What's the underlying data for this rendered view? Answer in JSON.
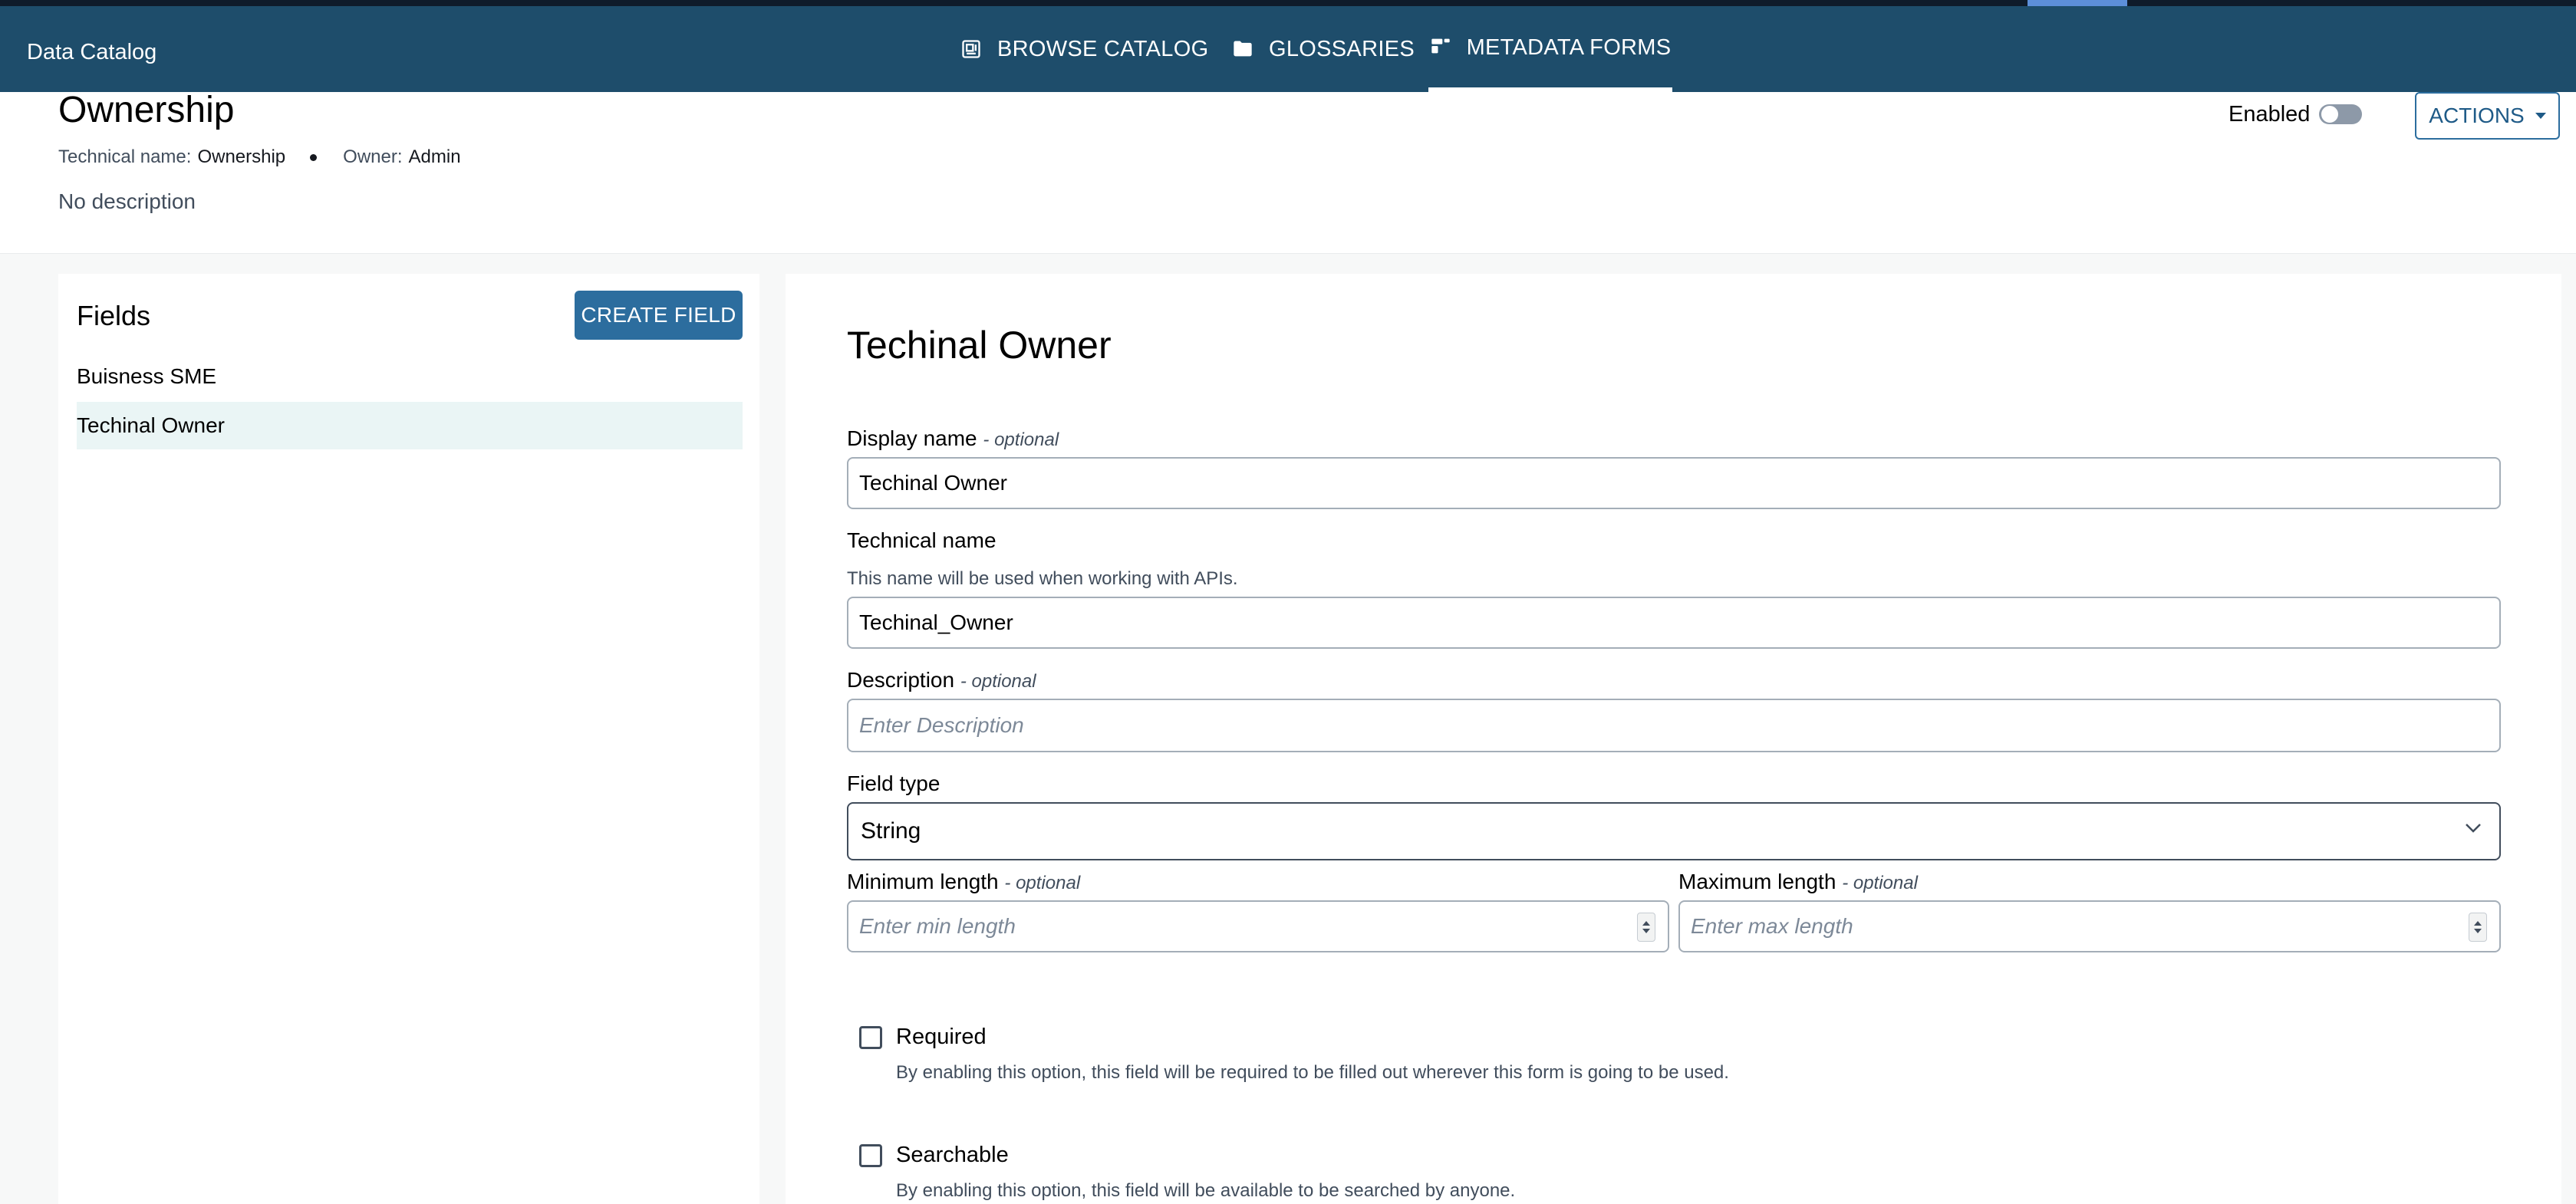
{
  "navbar": {
    "brand": "Data Catalog",
    "tabs": [
      {
        "label": "BROWSE CATALOG",
        "icon": "catalog-icon"
      },
      {
        "label": "GLOSSARIES",
        "icon": "folder-icon"
      },
      {
        "label": "METADATA FORMS",
        "icon": "form-icon",
        "active": true
      }
    ]
  },
  "header": {
    "title": "Ownership",
    "technical_name_label": "Technical name:",
    "technical_name_value": "Ownership",
    "owner_label": "Owner:",
    "owner_value": "Admin",
    "description": "No description",
    "enabled_label": "Enabled",
    "enabled": false,
    "actions_label": "ACTIONS"
  },
  "fields_panel": {
    "title": "Fields",
    "create_button": "CREATE FIELD",
    "items": [
      {
        "label": "Buisness SME",
        "selected": false
      },
      {
        "label": "Techinal Owner",
        "selected": true
      }
    ]
  },
  "detail": {
    "title": "Techinal Owner",
    "display_name": {
      "label": "Display name",
      "optional": "- optional",
      "value": "Techinal Owner"
    },
    "technical_name": {
      "label": "Technical name",
      "hint": "This name will be used when working with APIs.",
      "value": "Techinal_Owner"
    },
    "description": {
      "label": "Description",
      "optional": "- optional",
      "placeholder": "Enter Description"
    },
    "field_type": {
      "label": "Field type",
      "value": "String"
    },
    "min_length": {
      "label": "Minimum length",
      "optional": "- optional",
      "placeholder": "Enter min length"
    },
    "max_length": {
      "label": "Maximum length",
      "optional": "- optional",
      "placeholder": "Enter max length"
    },
    "required": {
      "label": "Required",
      "desc": "By enabling this option, this field will be required to be filled out wherever this form is going to be used.",
      "checked": false
    },
    "searchable": {
      "label": "Searchable",
      "desc": "By enabling this option, this field will be available to be searched by anyone.",
      "checked": false
    }
  },
  "colors": {
    "navbar": "#1e4d6b",
    "primary_button": "#2c6d9e",
    "selected_row": "#eaf5f5"
  }
}
